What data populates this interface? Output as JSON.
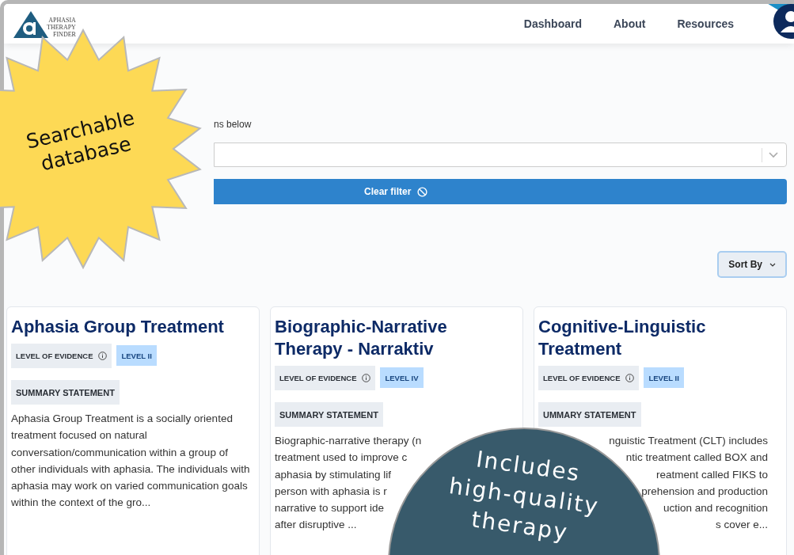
{
  "header": {
    "logo": {
      "lines": [
        "APHASIA",
        "THERAPY",
        "FINDER"
      ]
    },
    "nav": [
      "Dashboard",
      "About",
      "Resources"
    ]
  },
  "filter": {
    "instruction": "ns below",
    "clear_button": "Clear filter"
  },
  "sort_button": "Sort By",
  "cards": [
    {
      "title": "Aphasia Group Treatment",
      "evidence_label": "LEVEL OF EVIDENCE",
      "level": "LEVEL II",
      "summary_label": "SUMMARY STATEMENT",
      "summary": "Aphasia Group Treatment is a socially oriented treatment focused on natural conversation/communication within a group of other individuals with aphasia. The individuals with aphasia may work on varied communication goals within the context of the gro..."
    },
    {
      "title": "Biographic-Narrative Therapy - Narraktiv",
      "evidence_label": "LEVEL OF EVIDENCE",
      "level": "LEVEL IV",
      "summary_label": "SUMMARY STATEMENT",
      "summary_lines": [
        "Biographic-narrative therapy (n",
        "treatment used to improve c",
        "aphasia by stimulating lif",
        "person with aphasia is r",
        "narrative to support ide",
        "after disruptive ..."
      ]
    },
    {
      "title": "Cognitive-Linguistic Treatment",
      "evidence_label": "LEVEL OF EVIDENCE",
      "level": "LEVEL II",
      "summary_label": "UMMARY STATEMENT",
      "summary_lines": [
        "nguistic Treatment (CLT) includes",
        "ntic treatment called BOX and",
        "reatment called FIKS to",
        "prehension and production",
        "uction and recognition",
        "s cover e..."
      ]
    }
  ],
  "callouts": [
    {
      "kind": "starburst",
      "lines": [
        "Searchable",
        "database"
      ]
    },
    {
      "kind": "circle",
      "lines": [
        "Includes",
        "high-quality",
        "therapy"
      ]
    }
  ]
}
